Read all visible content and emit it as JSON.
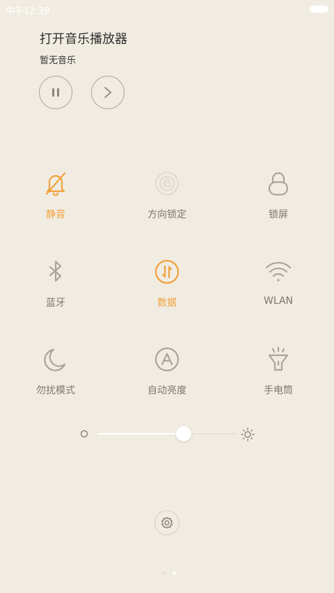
{
  "status_bar": {
    "time": "中午12:39"
  },
  "music": {
    "title": "打开音乐播放器",
    "subtitle": "暂无音乐"
  },
  "tiles": [
    {
      "label": "静音",
      "icon": "bell-off-icon",
      "active": true
    },
    {
      "label": "方向锁定",
      "icon": "rotation-lock-icon",
      "active": false
    },
    {
      "label": "锁屏",
      "icon": "lock-icon",
      "active": false
    },
    {
      "label": "蓝牙",
      "icon": "bluetooth-icon",
      "active": false
    },
    {
      "label": "数据",
      "icon": "mobile-data-icon",
      "active": true
    },
    {
      "label": "WLAN",
      "icon": "wifi-icon",
      "active": false
    },
    {
      "label": "勿扰模式",
      "icon": "moon-icon",
      "active": false
    },
    {
      "label": "自动亮度",
      "icon": "auto-brightness-icon",
      "active": false
    },
    {
      "label": "手电筒",
      "icon": "flashlight-icon",
      "active": false
    }
  ],
  "brightness": {
    "level": 0.62
  },
  "page_indicator": {
    "current": 2,
    "total": 2
  },
  "colors": {
    "background": "#f1ece2",
    "active": "#f0a13c",
    "inactive": "#a9a49c",
    "label": "#7b7670"
  }
}
